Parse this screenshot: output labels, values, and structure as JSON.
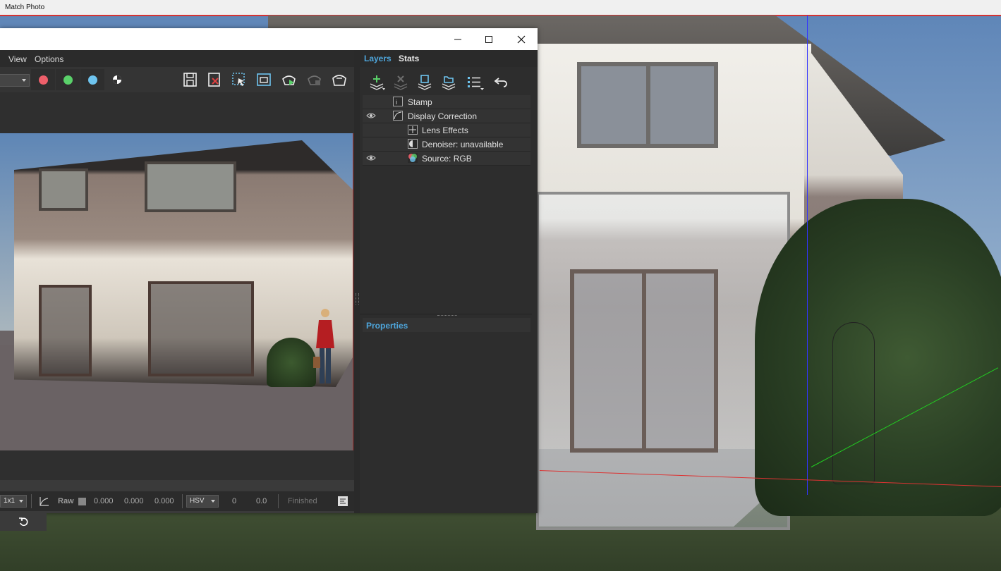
{
  "sketchup": {
    "match_photo_label": "Match Photo"
  },
  "vfb": {
    "menu": [
      "View",
      "Options"
    ],
    "window_controls": [
      "minimize-icon",
      "maximize-icon",
      "close-icon"
    ],
    "toolbar": {
      "channel_colors": [
        "#ee5f6a",
        "#5ad16a",
        "#6ec4ef"
      ],
      "tools": [
        "save-image-icon",
        "clear-image-icon",
        "region-render-icon",
        "track-mouse-icon",
        "start-interactive-icon",
        "stop-render-icon",
        "render-icon"
      ]
    },
    "statusbar": {
      "zoom": "1x1",
      "raw_label": "Raw",
      "rgb_values": [
        "0.000",
        "0.000",
        "0.000"
      ],
      "color_mode": "HSV",
      "h_value": "0",
      "s_value": "0.0",
      "status": "Finished"
    }
  },
  "panel": {
    "tabs": [
      "Layers",
      "Stats"
    ],
    "active_tab_color": "#4ea6dc",
    "layer_tools": [
      "add-layer-icon",
      "delete-layer-icon",
      "save-layers-icon",
      "load-layers-icon",
      "layer-list-icon",
      "undo-icon"
    ],
    "layers": [
      {
        "name": "Stamp",
        "visible": false,
        "icon": "stamp-icon",
        "indent": 1
      },
      {
        "name": "Display Correction",
        "visible": true,
        "icon": "curve-icon",
        "indent": 1
      },
      {
        "name": "Lens Effects",
        "visible": false,
        "icon": "lens-effects-icon",
        "indent": 2
      },
      {
        "name": "Denoiser: unavailable",
        "visible": false,
        "icon": "denoiser-icon",
        "indent": 2
      },
      {
        "name": "Source: RGB",
        "visible": true,
        "icon": "rgb-source-icon",
        "indent": 2
      }
    ],
    "properties_label": "Properties"
  }
}
